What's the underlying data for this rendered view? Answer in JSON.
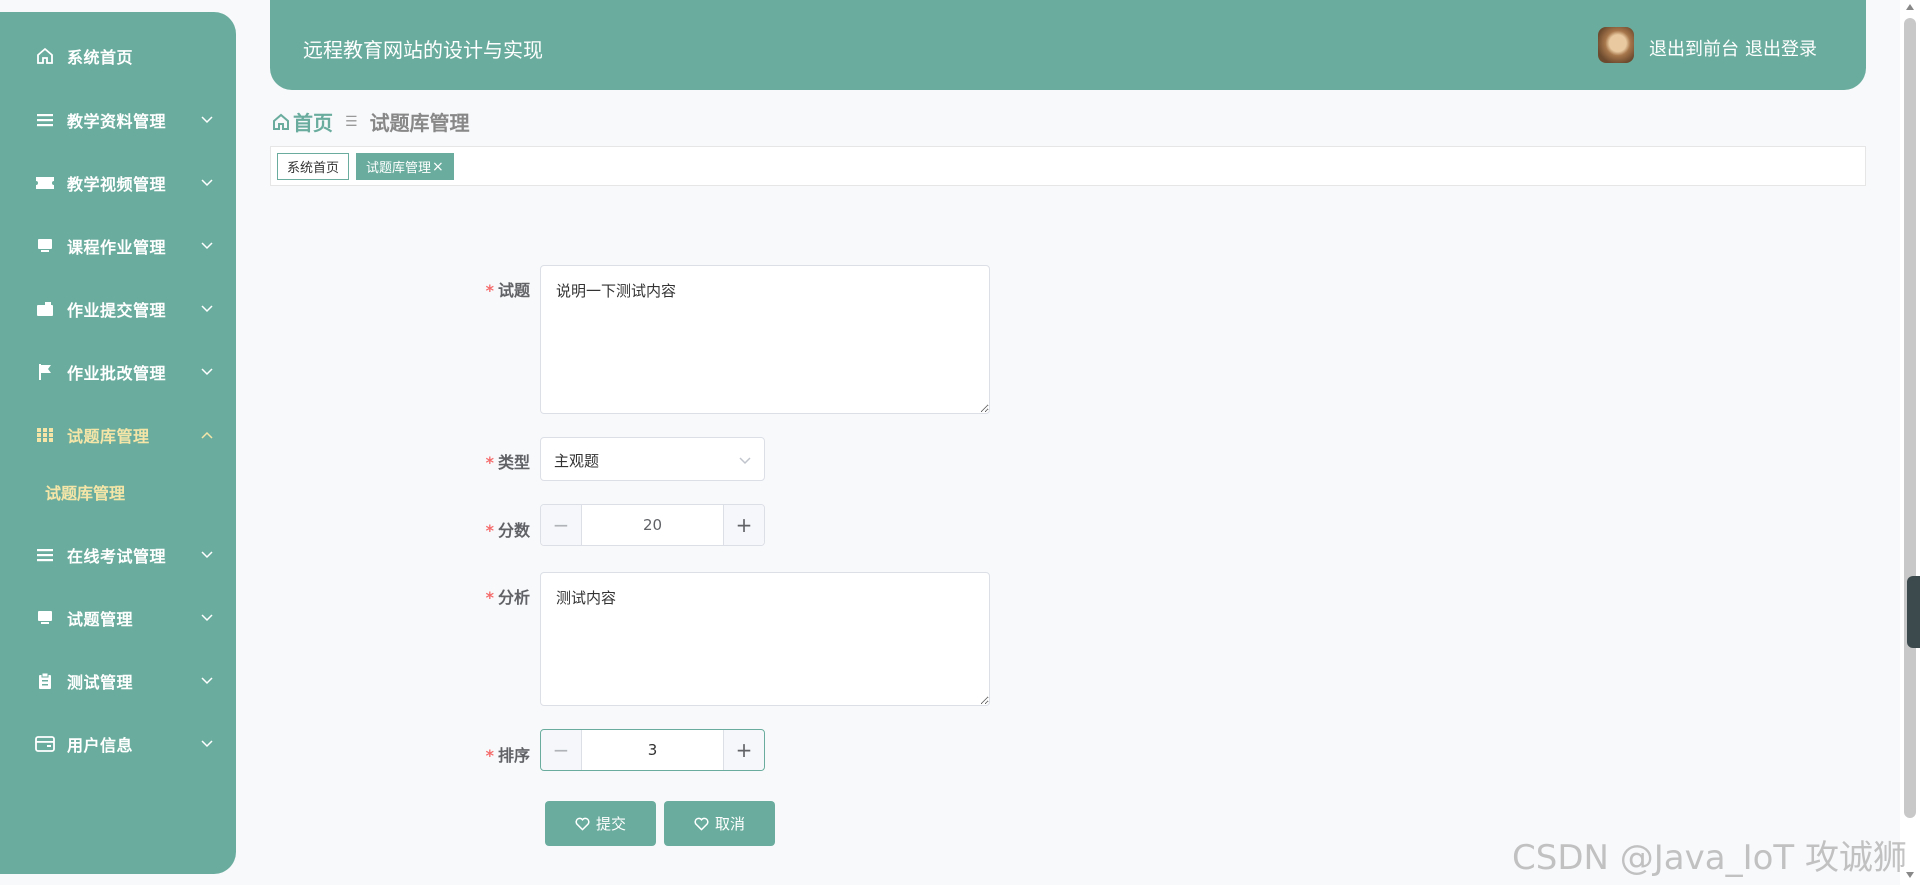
{
  "sidebar": {
    "items": [
      {
        "label": "系统首页",
        "icon": "home-icon"
      },
      {
        "label": "教学资料管理",
        "icon": "list-icon"
      },
      {
        "label": "教学视频管理",
        "icon": "ticket-icon"
      },
      {
        "label": "课程作业管理",
        "icon": "monitor-icon"
      },
      {
        "label": "作业提交管理",
        "icon": "wallet-icon"
      },
      {
        "label": "作业批改管理",
        "icon": "flag-icon"
      },
      {
        "label": "试题库管理",
        "icon": "grid-icon"
      },
      {
        "label": "在线考试管理",
        "icon": "list-icon"
      },
      {
        "label": "试题管理",
        "icon": "monitor-icon"
      },
      {
        "label": "测试管理",
        "icon": "clipboard-icon"
      },
      {
        "label": "用户信息",
        "icon": "card-icon"
      }
    ],
    "sub_item": "试题库管理"
  },
  "header": {
    "title": "远程教育网站的设计与实现",
    "to_front": "退出到前台",
    "logout": "退出登录"
  },
  "breadcrumb": {
    "home": "首页",
    "current": "试题库管理"
  },
  "tags": {
    "tag1": "系统首页",
    "tag2": "试题库管理",
    "close": "×"
  },
  "form": {
    "question_label": "试题",
    "question_value": "说明一下测试内容",
    "type_label": "类型",
    "type_value": "主观题",
    "score_label": "分数",
    "score_value": "20",
    "analysis_label": "分析",
    "analysis_value": "测试内容",
    "order_label": "排序",
    "order_value": "3",
    "required_mark": "*"
  },
  "buttons": {
    "submit": "提交",
    "cancel": "取消"
  },
  "watermark": "CSDN @Java_IoT 攻诚狮",
  "colors": {
    "primary": "#6aad9e",
    "active_text": "#f5e6a8",
    "required": "#f56c6c"
  }
}
